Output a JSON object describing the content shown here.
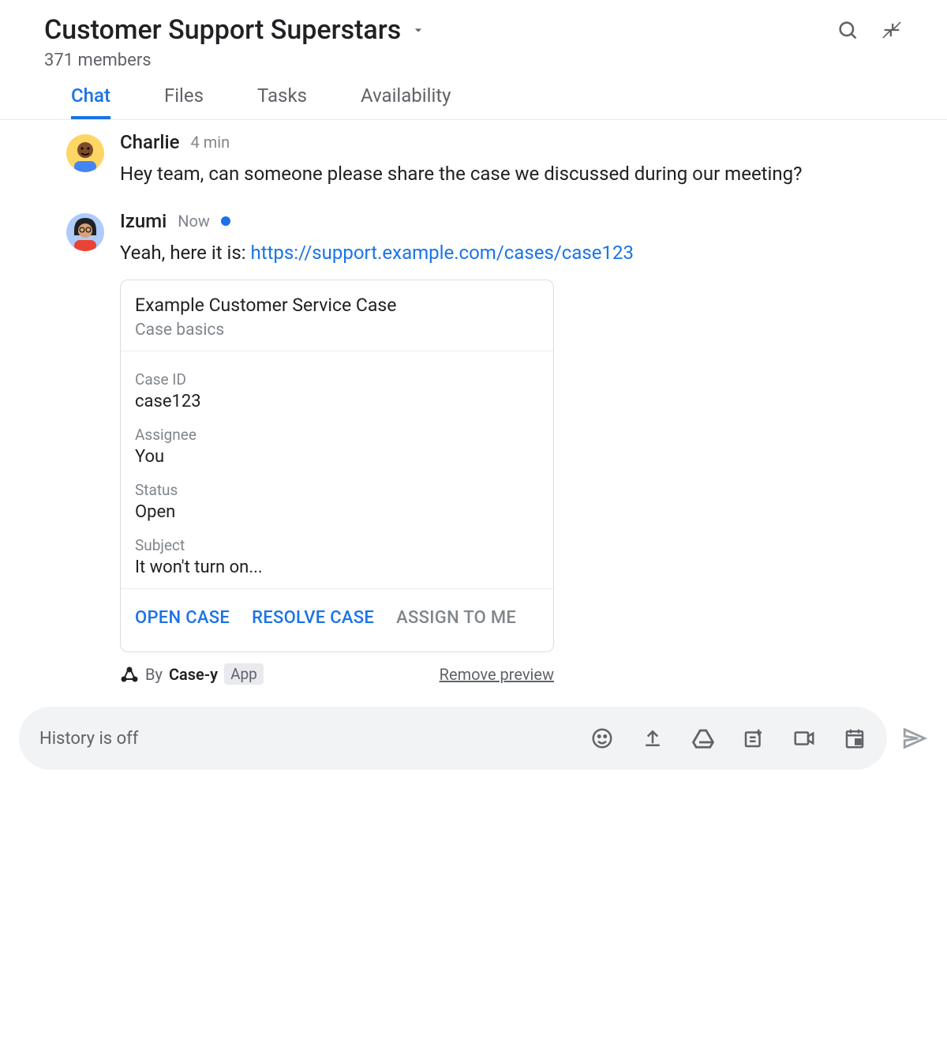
{
  "header": {
    "title": "Customer Support Superstars",
    "members": "371 members"
  },
  "tabs": [
    {
      "label": "Chat",
      "active": true
    },
    {
      "label": "Files",
      "active": false
    },
    {
      "label": "Tasks",
      "active": false
    },
    {
      "label": "Availability",
      "active": false
    }
  ],
  "messages": [
    {
      "author": "Charlie",
      "time": "4 min",
      "text": "Hey team, can someone please share the case we discussed during our meeting?"
    },
    {
      "author": "Izumi",
      "time": "Now",
      "hasDot": true,
      "textPrefix": "Yeah, here it is: ",
      "link": "https://support.example.com/cases/case123"
    }
  ],
  "card": {
    "title": "Example Customer Service Case",
    "subtitle": "Case basics",
    "fields": [
      {
        "label": "Case ID",
        "value": "case123"
      },
      {
        "label": "Assignee",
        "value": "You"
      },
      {
        "label": "Status",
        "value": "Open"
      },
      {
        "label": "Subject",
        "value": "It won't turn on..."
      }
    ],
    "actions": [
      {
        "label": "OPEN CASE",
        "disabled": false
      },
      {
        "label": "RESOLVE CASE",
        "disabled": false
      },
      {
        "label": "ASSIGN TO ME",
        "disabled": true
      }
    ],
    "byPrefix": "By",
    "appName": "Case-y",
    "appBadge": "App",
    "removeLabel": "Remove preview"
  },
  "composer": {
    "placeholder": "History is off"
  }
}
